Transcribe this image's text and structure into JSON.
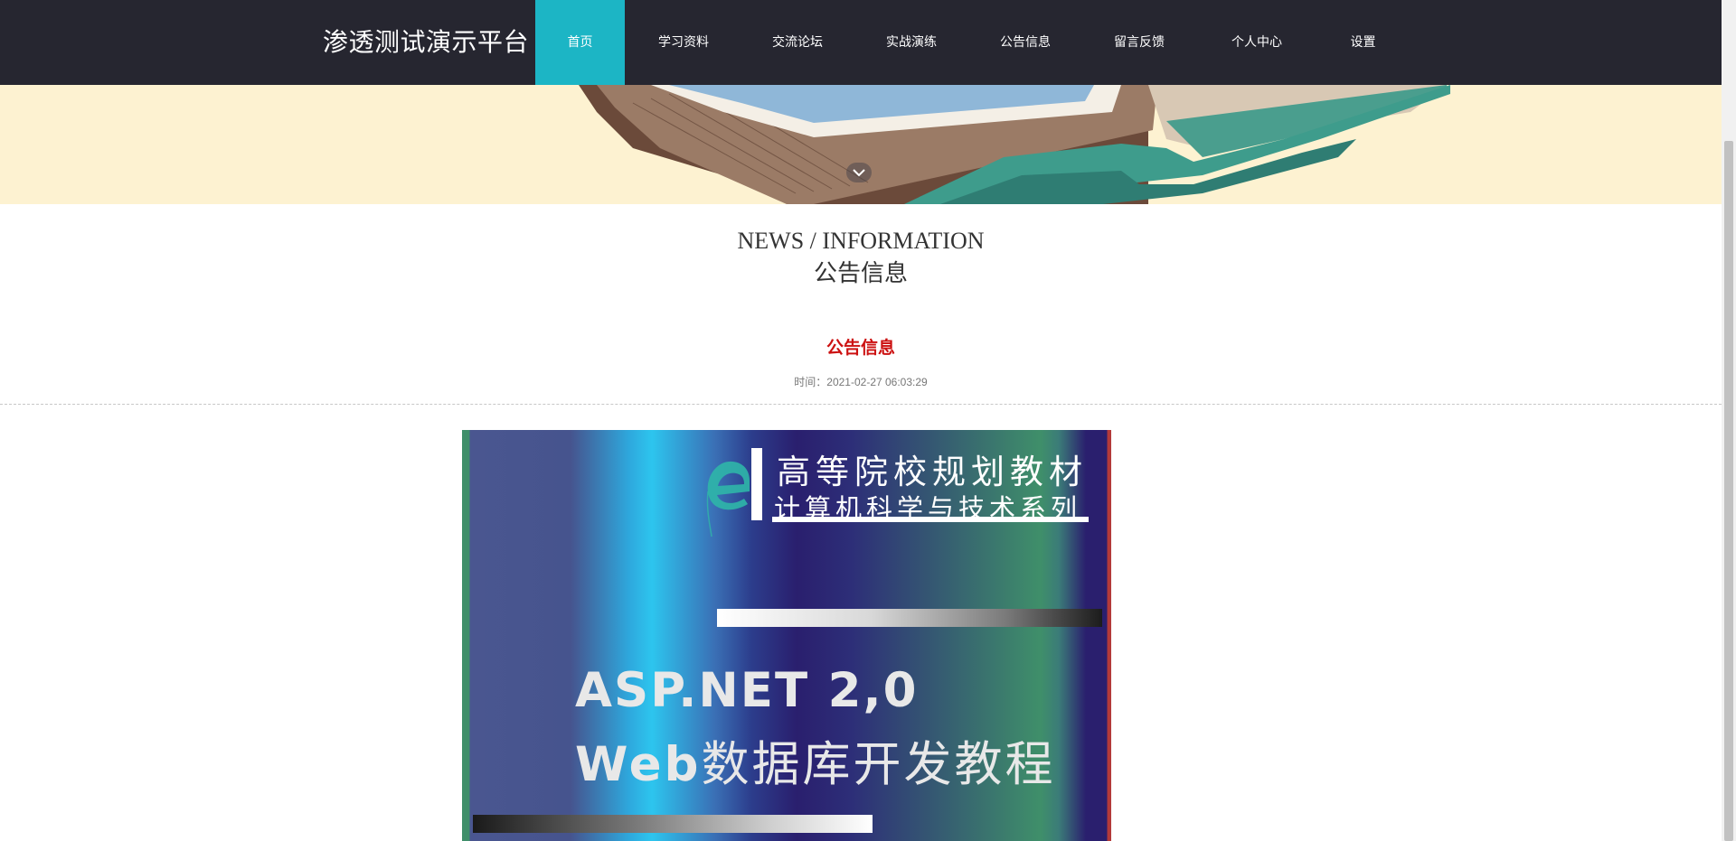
{
  "header": {
    "brand": "渗透测试演示平台",
    "nav": [
      {
        "label": "首页",
        "active": true
      },
      {
        "label": "学习资料",
        "active": false
      },
      {
        "label": "交流论坛",
        "active": false
      },
      {
        "label": "实战演练",
        "active": false
      },
      {
        "label": "公告信息",
        "active": false
      },
      {
        "label": "留言反馈",
        "active": false
      },
      {
        "label": "个人中心",
        "active": false
      },
      {
        "label": "设置",
        "active": false
      }
    ]
  },
  "banner": {
    "scroll_icon": "chevron-down-icon"
  },
  "section": {
    "title_en": "NEWS / INFORMATION",
    "title_cn": "公告信息"
  },
  "article": {
    "title": "公告信息",
    "time": "时间：2021-02-27 06:03:29"
  },
  "cover": {
    "series_line1": "高等院校规划教材",
    "series_line2": "计算机科学与技术系列",
    "title_line1": "ASP.NET 2,0",
    "title_line2_bold": "Web",
    "title_line2_rest": "数据库开发教程"
  },
  "colors": {
    "topbar": "#262630",
    "nav_active": "#1cb5c5",
    "banner_bg": "#fdf2d1",
    "article_title": "#cc1111"
  }
}
